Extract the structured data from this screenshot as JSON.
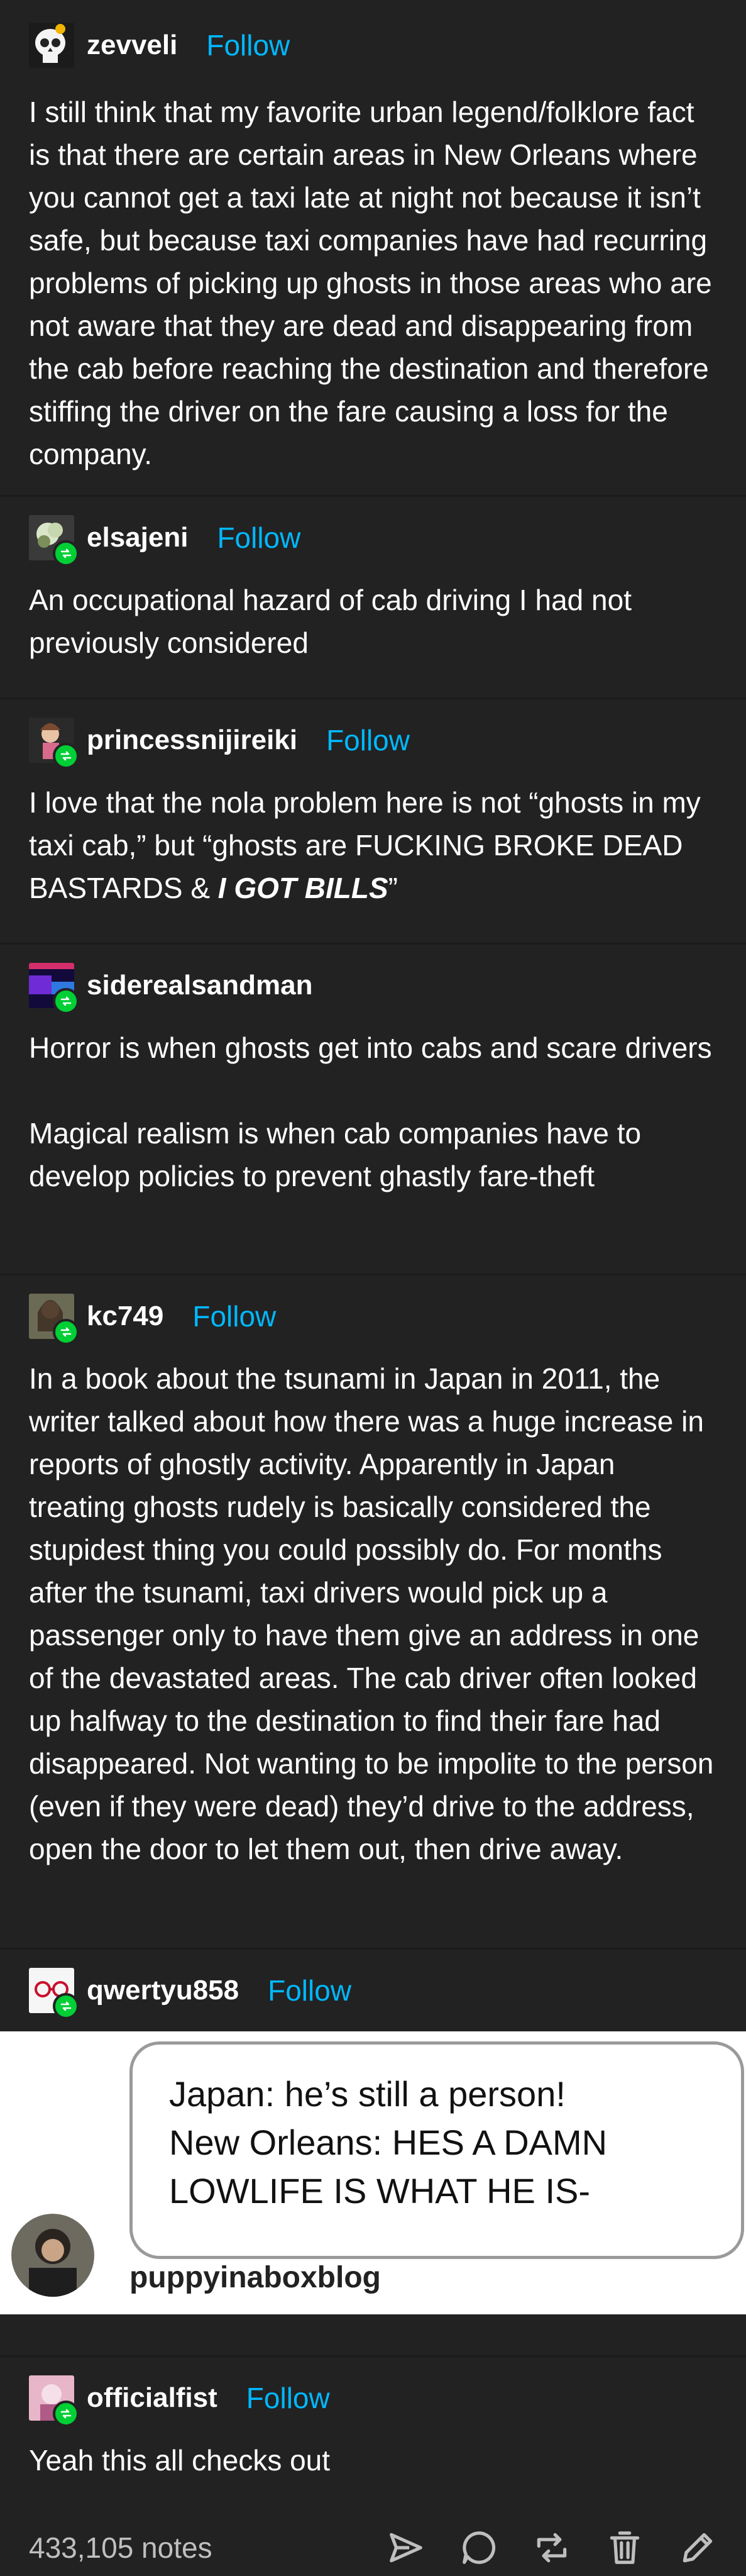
{
  "posts": [
    {
      "username": "zevveli",
      "follow": "Follow",
      "paragraphs": [
        "I still think that my favorite urban legend/folklore fact is that there are certain areas in New Orleans where you cannot get a taxi late at night not because it isn’t safe, but because taxi companies have had recurring problems of picking up ghosts in those areas who are not aware that they are dead and disappearing from the cab before reaching the destination and therefore stiffing the driver on the fare causing a loss for the company."
      ]
    },
    {
      "username": "elsajeni",
      "follow": "Follow",
      "paragraphs": [
        "An occupational hazard of cab driving I had not previously considered"
      ]
    },
    {
      "username": "princessnijireiki",
      "follow": "Follow",
      "text_before": "I love that the nola problem here is not “ghosts in my taxi cab,” but “ghosts are FUCKING BROKE DEAD BASTARDS & ",
      "text_emphasis": "I GOT BILLS",
      "text_after": "”"
    },
    {
      "username": "siderealsandman",
      "paragraphs": [
        "Horror is when ghosts get into cabs and scare drivers",
        "Magical realism is when cab companies have to develop policies to prevent ghastly fare-theft"
      ]
    },
    {
      "username": "kc749",
      "follow": "Follow",
      "paragraphs": [
        "In a book about the tsunami in Japan in 2011, the writer talked about how there was a huge increase in reports of ghostly activity. Apparently in Japan treating ghosts rudely is basically considered the stupidest thing you could possibly do. For months after the tsunami, taxi drivers would pick up a passenger only to have them give an address in one of the devastated areas. The cab driver often looked up halfway to the destination to find their fare had disappeared. Not wanting to be impolite to the person (even if they were dead) they’d drive to the address, open the door to let them out, then drive away."
      ]
    },
    {
      "username": "qwertyu858",
      "follow": "Follow",
      "image": {
        "lines": [
          "Japan: he’s still a person!",
          "New Orleans: HES A DAMN",
          "LOWLIFE IS WHAT HE IS-"
        ],
        "credit": "puppyinaboxblog"
      }
    },
    {
      "username": "officialfist",
      "follow": "Follow",
      "paragraphs": [
        "Yeah this all checks out"
      ]
    }
  ],
  "footer": {
    "notes": "433,105 notes",
    "icons": [
      "share-icon",
      "reply-icon",
      "reblog-icon",
      "delete-icon",
      "edit-icon"
    ]
  },
  "colors": {
    "background": "#222222",
    "follow": "#00b8ff",
    "reblog_badge": "#00cf35"
  }
}
